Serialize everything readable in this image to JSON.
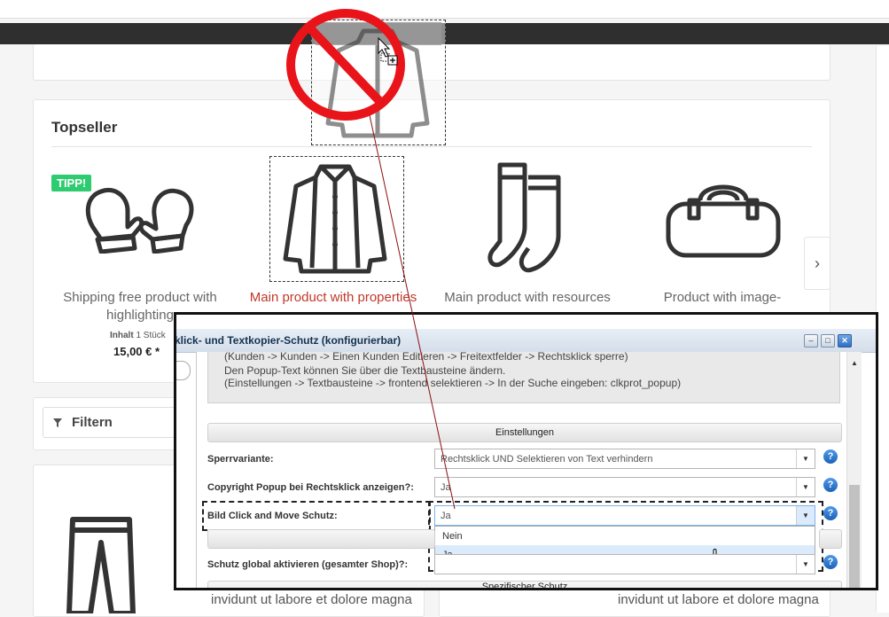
{
  "topseller": {
    "title": "Topseller",
    "badge": "TIPP!",
    "products": [
      {
        "name": "Shipping free product with highlighting",
        "content_label": "Inhalt",
        "content_value": "1 Stück",
        "price": "15,00 € *",
        "icon": "mittens-icon"
      },
      {
        "name": "Main product with properties",
        "icon": "jacket-icon",
        "highlighted": true
      },
      {
        "name": "Main product with resources",
        "icon": "socks-icon"
      },
      {
        "name": "Product with image-",
        "icon": "bag-icon"
      }
    ],
    "next_arrow": "›"
  },
  "filter": {
    "label": "Filtern",
    "icon": "filter-icon"
  },
  "bottom_text": {
    "left": "invidunt ut labore et dolore magna",
    "right": "invidunt ut labore et dolore magna"
  },
  "drag": {
    "icon": "no-entry-icon",
    "cursor": "drag-copy-cursor"
  },
  "dialog": {
    "title": "klick- und Textkopier-Schutz (konfigurierbar)",
    "window_buttons": {
      "minimize": "–",
      "maximize": "□",
      "close": "✕"
    },
    "info_lines": [
      "(Kunden -> Kunden -> Einen Kunden Editieren -> Freitextfelder -> Rechtsklick sperre)",
      "Den Popup-Text können Sie über die Textbausteine ändern.",
      "(Einstellungen -> Textbausteine -> frontend selektieren -> In der Suche eingeben: clkprot_popup)"
    ],
    "section_settings": "Einstellungen",
    "section_specific": "Spezifischer Schutz",
    "fields": [
      {
        "label": "Sperrvariante:",
        "value": "Rechtsklick UND Selektieren von Text verhindern"
      },
      {
        "label": "Copyright Popup bei Rechtsklick anzeigen?:",
        "value": "Ja"
      },
      {
        "label": "Bild Click and Move Schutz:",
        "value": "Ja"
      },
      {
        "label": "Schutz global aktivieren (gesamter Shop)?:",
        "value": ""
      }
    ],
    "dropdown_options": [
      "Nein",
      "Ja"
    ],
    "help_symbol": "?",
    "select_arrow": "▼",
    "scroll_up": "▲"
  }
}
